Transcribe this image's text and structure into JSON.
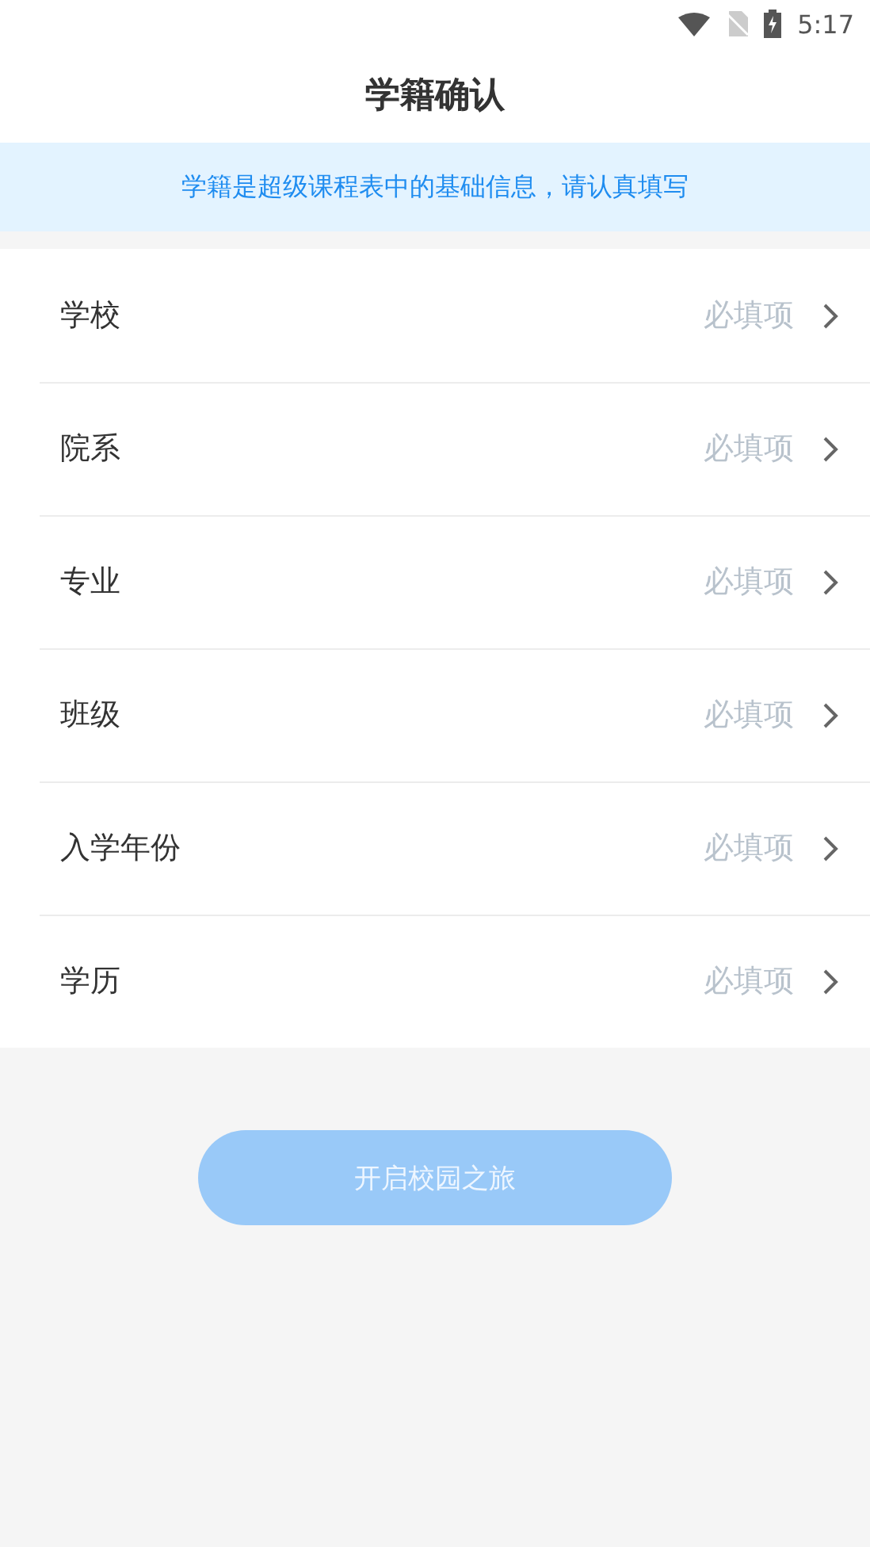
{
  "status_bar": {
    "time": "5:17"
  },
  "header": {
    "title": "学籍确认"
  },
  "notice": "学籍是超级课程表中的基础信息，请认真填写",
  "fields": [
    {
      "label": "学校",
      "placeholder": "必填项"
    },
    {
      "label": "院系",
      "placeholder": "必填项"
    },
    {
      "label": "专业",
      "placeholder": "必填项"
    },
    {
      "label": "班级",
      "placeholder": "必填项"
    },
    {
      "label": "入学年份",
      "placeholder": "必填项"
    },
    {
      "label": "学历",
      "placeholder": "必填项"
    }
  ],
  "submit": {
    "label": "开启校园之旅",
    "disabled": true
  }
}
